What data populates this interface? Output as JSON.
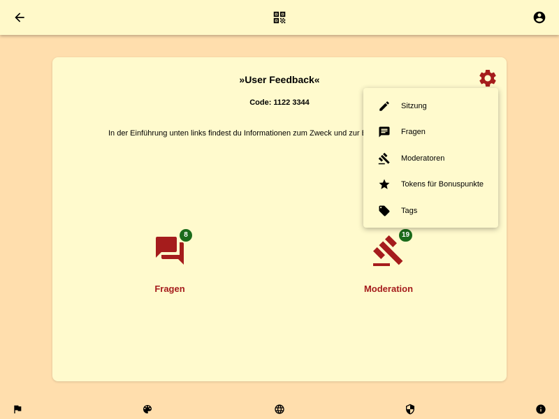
{
  "header": {
    "back_icon": "arrow-back-icon",
    "qr_icon": "qr-code-icon",
    "account_icon": "account-circle-icon"
  },
  "session": {
    "title": "»User Feedback«",
    "code": "Code: 1122 3344",
    "intro": "In der Einführung unten links findest du Informationen zum Zweck und zur B"
  },
  "features": [
    {
      "label": "Fragen",
      "badge": "8",
      "icon": "forum-icon"
    },
    {
      "label": "Moderation",
      "badge": "19",
      "icon": "gavel-icon"
    }
  ],
  "settings_menu": {
    "items": [
      {
        "label": "Sitzung",
        "icon": "edit-icon"
      },
      {
        "label": "Fragen",
        "icon": "comment-icon"
      },
      {
        "label": "Moderatoren",
        "icon": "gavel-icon"
      },
      {
        "label": "Tokens für Bonuspunkte",
        "icon": "star-icon"
      },
      {
        "label": "Tags",
        "icon": "tag-icon"
      }
    ]
  },
  "footer": {
    "icons": [
      "flag-icon",
      "palette-icon",
      "language-icon",
      "privacy-shield-icon",
      "info-icon"
    ]
  },
  "colors": {
    "background": "#ffdead",
    "surface": "#fffacd",
    "accent": "#a51c1c",
    "badge": "#1b6b1b"
  }
}
